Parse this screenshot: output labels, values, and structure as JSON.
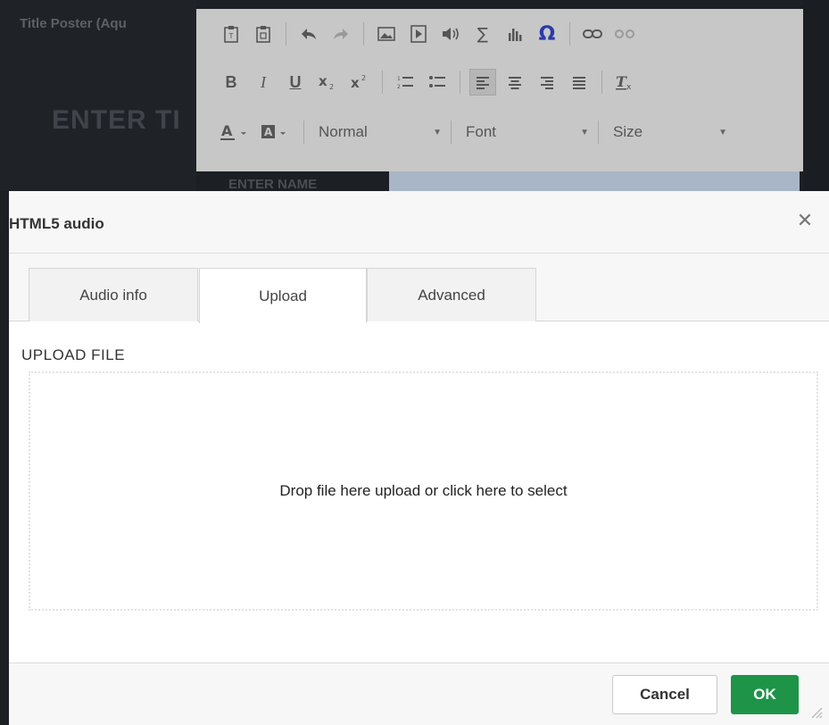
{
  "background": {
    "title": "Title Poster (Aqu",
    "heading": "ENTER TI",
    "sub": "ENTER NAME"
  },
  "toolbar": {
    "row1": [
      "paste-text-icon",
      "paste-word-icon",
      "undo-icon",
      "redo-icon",
      "image-icon",
      "video-icon",
      "audio-icon",
      "sigma-icon",
      "chart-icon",
      "omega-icon",
      "link-icon",
      "unlink-icon"
    ],
    "row2": [
      "bold-icon",
      "italic-icon",
      "underline-icon",
      "subscript-icon",
      "superscript-icon",
      "numbered-list-icon",
      "bullet-list-icon",
      "align-left-icon",
      "align-center-icon",
      "align-right-icon",
      "justify-icon",
      "clear-format-icon"
    ],
    "format_value": "Normal",
    "font_value": "Font",
    "size_value": "Size"
  },
  "dialog": {
    "title": "HTML5 audio",
    "tabs": [
      {
        "label": "Audio info"
      },
      {
        "label": "Upload"
      },
      {
        "label": "Advanced"
      }
    ],
    "active_tab": "Upload",
    "section_label": "UPLOAD FILE",
    "dropzone_text": "Drop file here upload or click here to select",
    "cancel_label": "Cancel",
    "ok_label": "OK"
  },
  "colors": {
    "ok_button": "#1e9448",
    "omega_icon": "#2b3aa8"
  }
}
